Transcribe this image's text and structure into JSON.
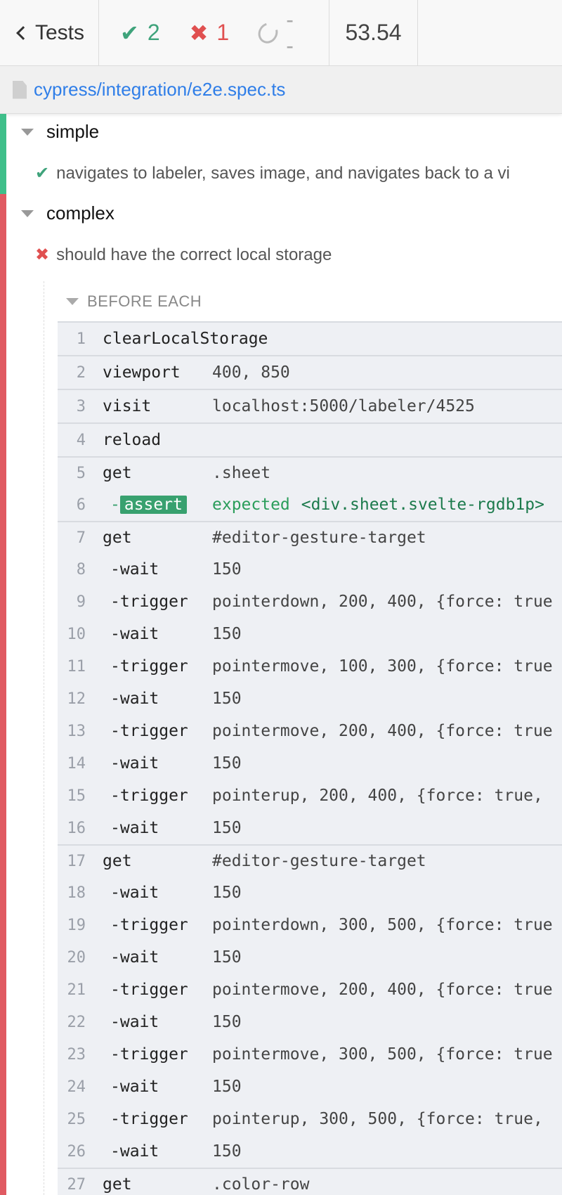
{
  "header": {
    "back_label": "Tests",
    "passed_count": "2",
    "failed_count": "1",
    "pending_count": "--",
    "duration": "53.54"
  },
  "spec": {
    "path": "cypress/integration/e2e.spec.ts"
  },
  "suites": [
    {
      "title": "simple",
      "tests": [
        {
          "title": "navigates to labeler, saves image, and navigates back to a vi",
          "state": "passed"
        }
      ]
    },
    {
      "title": "complex",
      "tests": [
        {
          "title": "should have the correct local storage",
          "state": "failed"
        }
      ]
    }
  ],
  "hook": {
    "title": "BEFORE EACH"
  },
  "commands": [
    {
      "num": "1",
      "name": "clearLocalStorage",
      "msg": ""
    },
    {
      "num": "2",
      "name": "viewport",
      "msg": "400, 850"
    },
    {
      "num": "3",
      "name": "visit",
      "msg": "localhost:5000/labeler/4525"
    },
    {
      "num": "4",
      "name": "reload",
      "msg": ""
    },
    {
      "num": "5",
      "name": "get",
      "msg": ".sheet"
    },
    {
      "num": "6",
      "name": "-",
      "badge": "assert",
      "msg": "expected",
      "value": "<div.sheet.svelte-rgdb1p>"
    },
    {
      "num": "7",
      "name": "get",
      "msg": "#editor-gesture-target"
    },
    {
      "num": "8",
      "name": "-wait",
      "msg": "150"
    },
    {
      "num": "9",
      "name": "-trigger",
      "msg": "pointerdown, 200, 400, {force: true"
    },
    {
      "num": "10",
      "name": "-wait",
      "msg": "150"
    },
    {
      "num": "11",
      "name": "-trigger",
      "msg": "pointermove, 100, 300, {force: true"
    },
    {
      "num": "12",
      "name": "-wait",
      "msg": "150"
    },
    {
      "num": "13",
      "name": "-trigger",
      "msg": "pointermove, 200, 400, {force: true"
    },
    {
      "num": "14",
      "name": "-wait",
      "msg": "150"
    },
    {
      "num": "15",
      "name": "-trigger",
      "msg": "pointerup, 200, 400, {force: true,"
    },
    {
      "num": "16",
      "name": "-wait",
      "msg": "150"
    },
    {
      "num": "17",
      "name": "get",
      "msg": "#editor-gesture-target"
    },
    {
      "num": "18",
      "name": "-wait",
      "msg": "150"
    },
    {
      "num": "19",
      "name": "-trigger",
      "msg": "pointerdown, 300, 500, {force: true"
    },
    {
      "num": "20",
      "name": "-wait",
      "msg": "150"
    },
    {
      "num": "21",
      "name": "-trigger",
      "msg": "pointermove, 200, 400, {force: true"
    },
    {
      "num": "22",
      "name": "-wait",
      "msg": "150"
    },
    {
      "num": "23",
      "name": "-trigger",
      "msg": "pointermove, 300, 500, {force: true"
    },
    {
      "num": "24",
      "name": "-wait",
      "msg": "150"
    },
    {
      "num": "25",
      "name": "-trigger",
      "msg": "pointerup, 300, 500, {force: true,"
    },
    {
      "num": "26",
      "name": "-wait",
      "msg": "150"
    },
    {
      "num": "27",
      "name": "get",
      "msg": ".color-row"
    }
  ]
}
